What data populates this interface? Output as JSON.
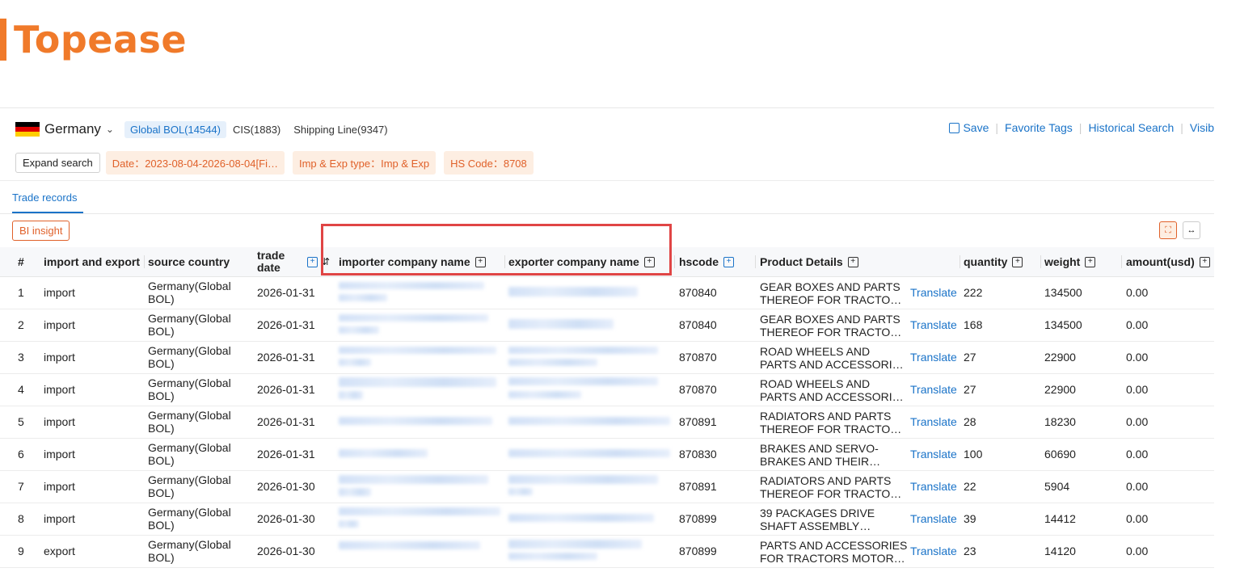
{
  "brand": {
    "logo_text": "Topease",
    "accent": "#f07a2a"
  },
  "filters": {
    "country": "Germany",
    "flag_colors": [
      "#000000",
      "#dd0000",
      "#ffce00"
    ],
    "source_tabs": [
      "Global BOL(14544)",
      "CIS(1883)",
      "Shipping Line(9347)"
    ],
    "expand_label": "Expand search",
    "chips": [
      "Date：2023-08-04-2026-08-04[Fi…",
      "Imp & Exp type：Imp & Exp",
      "HS Code：8708"
    ]
  },
  "actions": {
    "save": "Save",
    "favorite": "Favorite Tags",
    "history": "Historical Search",
    "visible": "Visib"
  },
  "tabs": {
    "trade_records": "Trade records"
  },
  "bi_label": "BI insight",
  "columns": {
    "num": "#",
    "ie": "import and export",
    "source": "source country",
    "date": "trade date",
    "importer": "importer company name",
    "exporter": "exporter company name",
    "hscode": "hscode",
    "product": "Product Details",
    "quantity": "quantity",
    "weight": "weight",
    "amount": "amount(usd)"
  },
  "translate_label": "Translate",
  "rows": [
    {
      "num": "1",
      "ie": "import",
      "source": "Germany(Global BOL)",
      "date": "2026-01-31",
      "hs": "870840",
      "product": "GEAR BOXES AND PARTS THEREOF FOR TRACTO…",
      "qty": "222",
      "weight": "134500",
      "amount": "0.00"
    },
    {
      "num": "2",
      "ie": "import",
      "source": "Germany(Global BOL)",
      "date": "2026-01-31",
      "hs": "870840",
      "product": "GEAR BOXES AND PARTS THEREOF FOR TRACTO…",
      "qty": "168",
      "weight": "134500",
      "amount": "0.00"
    },
    {
      "num": "3",
      "ie": "import",
      "source": "Germany(Global BOL)",
      "date": "2026-01-31",
      "hs": "870870",
      "product": "ROAD WHEELS AND PARTS AND ACCESSORI…",
      "qty": "27",
      "weight": "22900",
      "amount": "0.00"
    },
    {
      "num": "4",
      "ie": "import",
      "source": "Germany(Global BOL)",
      "date": "2026-01-31",
      "hs": "870870",
      "product": "ROAD WHEELS AND PARTS AND ACCESSORI…",
      "qty": "27",
      "weight": "22900",
      "amount": "0.00"
    },
    {
      "num": "5",
      "ie": "import",
      "source": "Germany(Global BOL)",
      "date": "2026-01-31",
      "hs": "870891",
      "product": "RADIATORS AND PARTS THEREOF FOR TRACTO…",
      "qty": "28",
      "weight": "18230",
      "amount": "0.00"
    },
    {
      "num": "6",
      "ie": "import",
      "source": "Germany(Global BOL)",
      "date": "2026-01-31",
      "hs": "870830",
      "product": "BRAKES AND SERVO-BRAKES AND THEIR…",
      "qty": "100",
      "weight": "60690",
      "amount": "0.00"
    },
    {
      "num": "7",
      "ie": "import",
      "source": "Germany(Global BOL)",
      "date": "2026-01-30",
      "hs": "870891",
      "product": "RADIATORS AND PARTS THEREOF FOR TRACTO…",
      "qty": "22",
      "weight": "5904",
      "amount": "0.00"
    },
    {
      "num": "8",
      "ie": "import",
      "source": "Germany(Global BOL)",
      "date": "2026-01-30",
      "hs": "870899",
      "product": "39 PACKAGES DRIVE SHAFT ASSEMBLY…",
      "qty": "39",
      "weight": "14412",
      "amount": "0.00"
    },
    {
      "num": "9",
      "ie": "export",
      "source": "Germany(Global BOL)",
      "date": "2026-01-30",
      "hs": "870899",
      "product": "PARTS AND ACCESSORIES FOR TRACTORS MOTOR…",
      "qty": "23",
      "weight": "14120",
      "amount": "0.00"
    }
  ]
}
